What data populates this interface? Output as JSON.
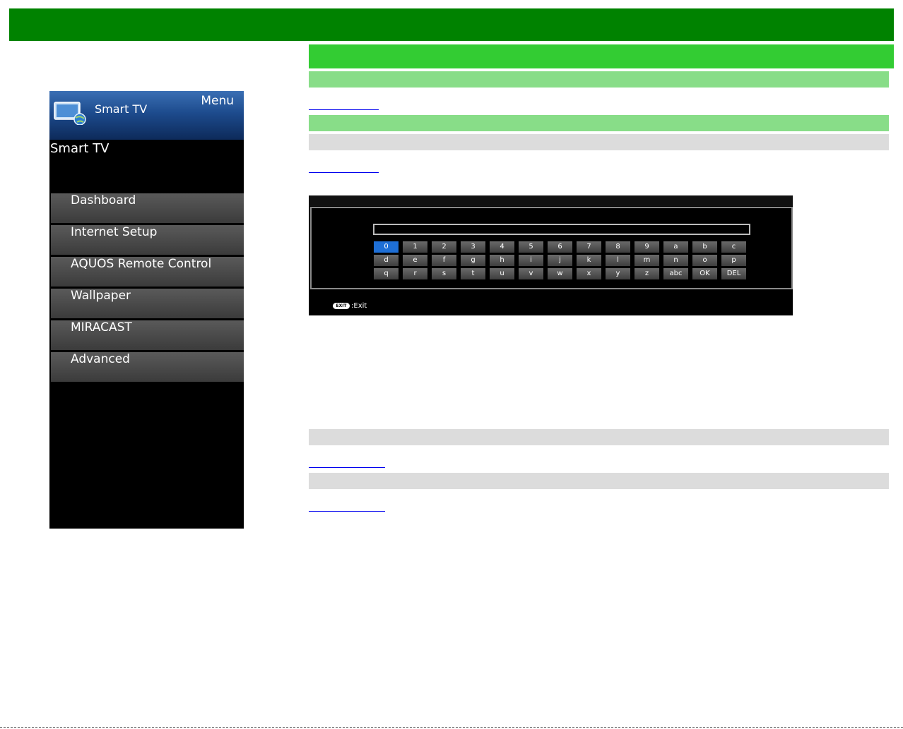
{
  "menu": {
    "app_name": "Smart TV",
    "menu_label": "Menu",
    "title": "Smart TV",
    "items": [
      {
        "label": "Dashboard"
      },
      {
        "label": "Internet Setup"
      },
      {
        "label": "AQUOS Remote Control"
      },
      {
        "label": "Wallpaper"
      },
      {
        "label": "MIRACAST"
      },
      {
        "label": "Advanced"
      }
    ]
  },
  "keyboard": {
    "input_value": "",
    "selected_key": "0",
    "keys": [
      "0",
      "1",
      "2",
      "3",
      "4",
      "5",
      "6",
      "7",
      "8",
      "9",
      "a",
      "b",
      "c",
      "d",
      "e",
      "f",
      "g",
      "h",
      "i",
      "j",
      "k",
      "l",
      "m",
      "n",
      "o",
      "p",
      "q",
      "r",
      "s",
      "t",
      "u",
      "v",
      "w",
      "x",
      "y",
      "z",
      "abc",
      "OK",
      "DEL"
    ],
    "exit_button": "EXIT",
    "exit_label": ":Exit"
  },
  "colors": {
    "header": "#008200",
    "section": "#33cc33",
    "subsection": "#88dd88",
    "note": "#dcdcdc"
  }
}
